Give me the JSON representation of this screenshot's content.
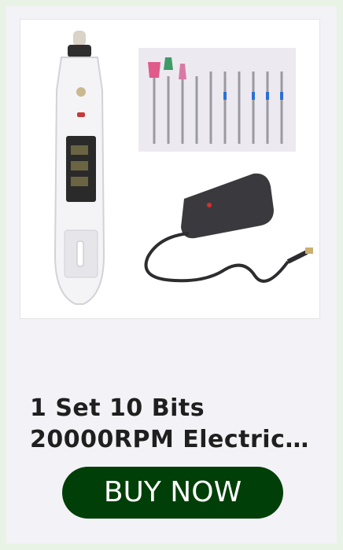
{
  "product": {
    "image_alt": "Electric nail drill pen with 10 bits and power adapter",
    "title_line_1": "1 Set 10 Bits",
    "title_line_2": "20000RPM Electric…",
    "accent_color": "#003f07"
  },
  "actions": {
    "buy_label": "BUY NOW"
  }
}
